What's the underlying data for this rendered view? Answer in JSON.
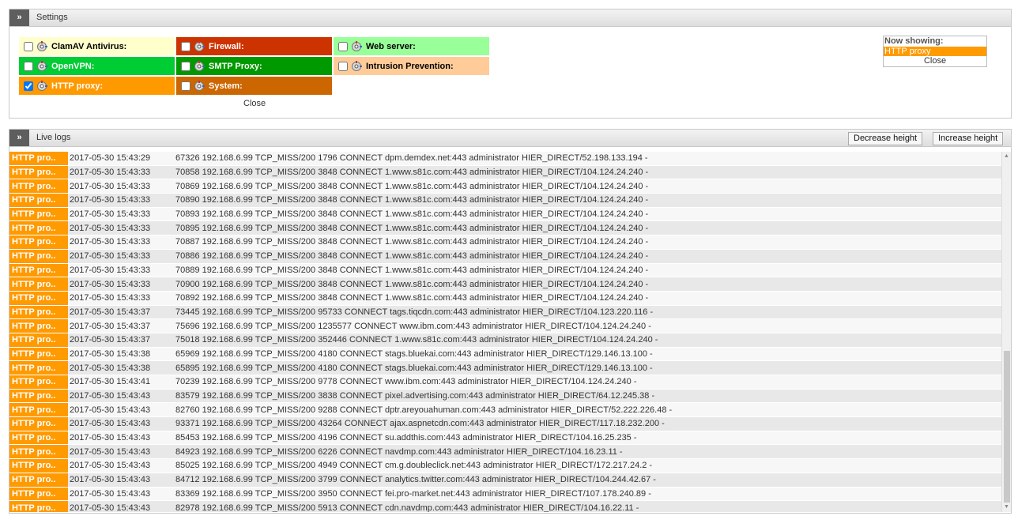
{
  "settings": {
    "title": "Settings",
    "toggle": "»",
    "categories": [
      {
        "label": "ClamAV Antivirus:",
        "checked": false,
        "bg": "#ffffcc",
        "fg": "#000000"
      },
      {
        "label": "Firewall:",
        "checked": false,
        "bg": "#cc3300",
        "fg": "#ffffff"
      },
      {
        "label": "Web server:",
        "checked": false,
        "bg": "#99ff99",
        "fg": "#000000"
      },
      {
        "label": "OpenVPN:",
        "checked": false,
        "bg": "#00cc33",
        "fg": "#ffffff"
      },
      {
        "label": "SMTP Proxy:",
        "checked": false,
        "bg": "#009900",
        "fg": "#ffffff"
      },
      {
        "label": "Intrusion Prevention:",
        "checked": false,
        "bg": "#ffcc99",
        "fg": "#000000"
      },
      {
        "label": "HTTP proxy:",
        "checked": true,
        "bg": "#ff9900",
        "fg": "#ffffff"
      },
      {
        "label": "System:",
        "checked": false,
        "bg": "#cc6600",
        "fg": "#ffffff"
      }
    ],
    "close_label": "Close",
    "now_showing": {
      "label": "Now showing:",
      "item": "HTTP proxy",
      "close_label": "Close"
    }
  },
  "livelogs": {
    "title": "Live logs",
    "toggle": "»",
    "decrease_label": "Decrease height",
    "increase_label": "Increase height",
    "rows": [
      {
        "src": "HTTP pro..",
        "time": "2017-05-30 15:43:29",
        "msg": "67326 192.168.6.99 TCP_MISS/200 1796 CONNECT dpm.demdex.net:443 administrator HIER_DIRECT/52.198.133.194 -"
      },
      {
        "src": "HTTP pro..",
        "time": "2017-05-30 15:43:33",
        "msg": "70858 192.168.6.99 TCP_MISS/200 3848 CONNECT 1.www.s81c.com:443 administrator HIER_DIRECT/104.124.24.240 -"
      },
      {
        "src": "HTTP pro..",
        "time": "2017-05-30 15:43:33",
        "msg": "70869 192.168.6.99 TCP_MISS/200 3848 CONNECT 1.www.s81c.com:443 administrator HIER_DIRECT/104.124.24.240 -"
      },
      {
        "src": "HTTP pro..",
        "time": "2017-05-30 15:43:33",
        "msg": "70890 192.168.6.99 TCP_MISS/200 3848 CONNECT 1.www.s81c.com:443 administrator HIER_DIRECT/104.124.24.240 -"
      },
      {
        "src": "HTTP pro..",
        "time": "2017-05-30 15:43:33",
        "msg": "70893 192.168.6.99 TCP_MISS/200 3848 CONNECT 1.www.s81c.com:443 administrator HIER_DIRECT/104.124.24.240 -"
      },
      {
        "src": "HTTP pro..",
        "time": "2017-05-30 15:43:33",
        "msg": "70895 192.168.6.99 TCP_MISS/200 3848 CONNECT 1.www.s81c.com:443 administrator HIER_DIRECT/104.124.24.240 -"
      },
      {
        "src": "HTTP pro..",
        "time": "2017-05-30 15:43:33",
        "msg": "70887 192.168.6.99 TCP_MISS/200 3848 CONNECT 1.www.s81c.com:443 administrator HIER_DIRECT/104.124.24.240 -"
      },
      {
        "src": "HTTP pro..",
        "time": "2017-05-30 15:43:33",
        "msg": "70886 192.168.6.99 TCP_MISS/200 3848 CONNECT 1.www.s81c.com:443 administrator HIER_DIRECT/104.124.24.240 -"
      },
      {
        "src": "HTTP pro..",
        "time": "2017-05-30 15:43:33",
        "msg": "70889 192.168.6.99 TCP_MISS/200 3848 CONNECT 1.www.s81c.com:443 administrator HIER_DIRECT/104.124.24.240 -"
      },
      {
        "src": "HTTP pro..",
        "time": "2017-05-30 15:43:33",
        "msg": "70900 192.168.6.99 TCP_MISS/200 3848 CONNECT 1.www.s81c.com:443 administrator HIER_DIRECT/104.124.24.240 -"
      },
      {
        "src": "HTTP pro..",
        "time": "2017-05-30 15:43:33",
        "msg": "70892 192.168.6.99 TCP_MISS/200 3848 CONNECT 1.www.s81c.com:443 administrator HIER_DIRECT/104.124.24.240 -"
      },
      {
        "src": "HTTP pro..",
        "time": "2017-05-30 15:43:37",
        "msg": "73445 192.168.6.99 TCP_MISS/200 95733 CONNECT tags.tiqcdn.com:443 administrator HIER_DIRECT/104.123.220.116 -"
      },
      {
        "src": "HTTP pro..",
        "time": "2017-05-30 15:43:37",
        "msg": "75696 192.168.6.99 TCP_MISS/200 1235577 CONNECT www.ibm.com:443 administrator HIER_DIRECT/104.124.24.240 -"
      },
      {
        "src": "HTTP pro..",
        "time": "2017-05-30 15:43:37",
        "msg": "75018 192.168.6.99 TCP_MISS/200 352446 CONNECT 1.www.s81c.com:443 administrator HIER_DIRECT/104.124.24.240 -"
      },
      {
        "src": "HTTP pro..",
        "time": "2017-05-30 15:43:38",
        "msg": "65969 192.168.6.99 TCP_MISS/200 4180 CONNECT stags.bluekai.com:443 administrator HIER_DIRECT/129.146.13.100 -"
      },
      {
        "src": "HTTP pro..",
        "time": "2017-05-30 15:43:38",
        "msg": "65895 192.168.6.99 TCP_MISS/200 4180 CONNECT stags.bluekai.com:443 administrator HIER_DIRECT/129.146.13.100 -"
      },
      {
        "src": "HTTP pro..",
        "time": "2017-05-30 15:43:41",
        "msg": "70239 192.168.6.99 TCP_MISS/200 9778 CONNECT www.ibm.com:443 administrator HIER_DIRECT/104.124.24.240 -"
      },
      {
        "src": "HTTP pro..",
        "time": "2017-05-30 15:43:43",
        "msg": "83579 192.168.6.99 TCP_MISS/200 3838 CONNECT pixel.advertising.com:443 administrator HIER_DIRECT/64.12.245.38 -"
      },
      {
        "src": "HTTP pro..",
        "time": "2017-05-30 15:43:43",
        "msg": "82760 192.168.6.99 TCP_MISS/200 9288 CONNECT dptr.areyouahuman.com:443 administrator HIER_DIRECT/52.222.226.48 -"
      },
      {
        "src": "HTTP pro..",
        "time": "2017-05-30 15:43:43",
        "msg": "93371 192.168.6.99 TCP_MISS/200 43264 CONNECT ajax.aspnetcdn.com:443 administrator HIER_DIRECT/117.18.232.200 -"
      },
      {
        "src": "HTTP pro..",
        "time": "2017-05-30 15:43:43",
        "msg": "85453 192.168.6.99 TCP_MISS/200 4196 CONNECT su.addthis.com:443 administrator HIER_DIRECT/104.16.25.235 -"
      },
      {
        "src": "HTTP pro..",
        "time": "2017-05-30 15:43:43",
        "msg": "84923 192.168.6.99 TCP_MISS/200 6226 CONNECT navdmp.com:443 administrator HIER_DIRECT/104.16.23.11 -"
      },
      {
        "src": "HTTP pro..",
        "time": "2017-05-30 15:43:43",
        "msg": "85025 192.168.6.99 TCP_MISS/200 4949 CONNECT cm.g.doubleclick.net:443 administrator HIER_DIRECT/172.217.24.2 -"
      },
      {
        "src": "HTTP pro..",
        "time": "2017-05-30 15:43:43",
        "msg": "84712 192.168.6.99 TCP_MISS/200 3799 CONNECT analytics.twitter.com:443 administrator HIER_DIRECT/104.244.42.67 -"
      },
      {
        "src": "HTTP pro..",
        "time": "2017-05-30 15:43:43",
        "msg": "83369 192.168.6.99 TCP_MISS/200 3950 CONNECT fei.pro-market.net:443 administrator HIER_DIRECT/107.178.240.89 -"
      },
      {
        "src": "HTTP pro..",
        "time": "2017-05-30 15:43:43",
        "msg": "82978 192.168.6.99 TCP_MISS/200 5913 CONNECT cdn.navdmp.com:443 administrator HIER_DIRECT/104.16.22.11 -"
      }
    ]
  }
}
